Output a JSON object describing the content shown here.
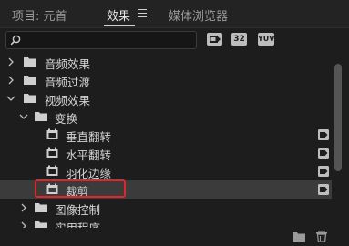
{
  "tabs": [
    {
      "label": "项目: 元首",
      "active": false
    },
    {
      "label": "效果",
      "active": true
    },
    {
      "label": "媒体浏览器",
      "active": false
    }
  ],
  "search": {
    "value": "",
    "placeholder": ""
  },
  "filter_buttons": [
    {
      "name": "accelerated-effects-filter",
      "label": ""
    },
    {
      "name": "32bit-filter",
      "label": "32"
    },
    {
      "name": "yuv-filter",
      "label": "YUV"
    }
  ],
  "tree": [
    {
      "label": "音频效果",
      "type": "folder",
      "expanded": false
    },
    {
      "label": "音频过渡",
      "type": "folder",
      "expanded": false
    },
    {
      "label": "视频效果",
      "type": "folder",
      "expanded": true
    },
    {
      "label": "变换",
      "type": "folder",
      "expanded": true
    },
    {
      "label": "垂直翻转",
      "type": "effect"
    },
    {
      "label": "水平翻转",
      "type": "effect"
    },
    {
      "label": "羽化边缘",
      "type": "effect"
    },
    {
      "label": "裁剪",
      "type": "effect",
      "selected": true
    },
    {
      "label": "图像控制",
      "type": "folder",
      "expanded": false
    },
    {
      "label": "实用程序",
      "type": "folder",
      "expanded": false
    }
  ],
  "colors": {
    "panel_bg": "#1d1d1d",
    "selection_bg": "#3b3b3b",
    "highlight_border": "#e0262b"
  },
  "icons": {
    "search": "search-icon",
    "folder": "folder-icon",
    "effect": "effect-icon",
    "new_bin": "new-bin-icon",
    "trash": "trash-icon"
  }
}
